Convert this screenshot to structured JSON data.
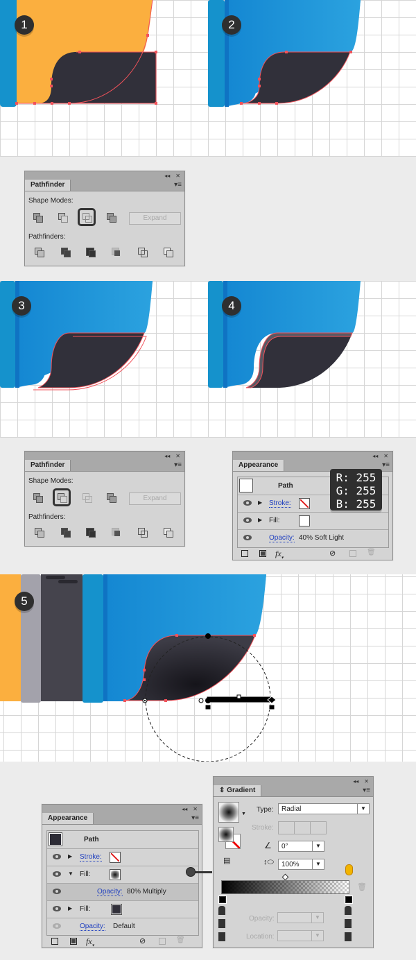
{
  "steps": [
    {
      "number": "1"
    },
    {
      "number": "2"
    },
    {
      "number": "3"
    },
    {
      "number": "4"
    },
    {
      "number": "5"
    }
  ],
  "colors": {
    "orange": "#fbaf3f",
    "blue": "#1a8fd6",
    "blue_dark": "#0f73c3",
    "dark_shape": "#31303a",
    "anchor_red": "#f2525a",
    "gray_strip": "#a3a2ab",
    "zipper": "#45444d"
  },
  "pathfinder_panel_1": {
    "title": "Pathfinder",
    "shape_modes_label": "Shape Modes:",
    "pathfinders_label": "Pathfinders:",
    "expand_label": "Expand",
    "selected_shape_mode": "intersect",
    "shape_modes": [
      "unite",
      "minus-front",
      "intersect",
      "exclude"
    ],
    "pathfinders": [
      "divide",
      "trim",
      "merge",
      "crop",
      "outline",
      "minus-back"
    ]
  },
  "pathfinder_panel_2": {
    "title": "Pathfinder",
    "shape_modes_label": "Shape Modes:",
    "pathfinders_label": "Pathfinders:",
    "expand_label": "Expand",
    "selected_shape_mode": "minus-front"
  },
  "appearance_panel_1": {
    "title": "Appearance",
    "header": "Path",
    "rows": [
      {
        "label": "Stroke:",
        "swatch": "none"
      },
      {
        "label": "Fill:",
        "swatch": "white"
      },
      {
        "label": "Opacity:",
        "value": "40% Soft Light"
      }
    ],
    "tooltip": {
      "r": "R: 255",
      "g": "G: 255",
      "b": "B: 255"
    }
  },
  "appearance_panel_2": {
    "title": "Appearance",
    "header": "Path",
    "rows": [
      {
        "label": "Stroke:",
        "swatch": "none"
      },
      {
        "label": "Fill:",
        "swatch": "radial-gradient"
      },
      {
        "label": "Opacity:",
        "value": "80% Multiply"
      },
      {
        "label": "Fill:",
        "swatch": "dark"
      },
      {
        "label": "Opacity:",
        "value": "Default"
      }
    ]
  },
  "gradient_panel": {
    "title": "Gradient",
    "type_label": "Type:",
    "type_value": "Radial",
    "stroke_label": "Stroke:",
    "angle_value": "0°",
    "aspect_value": "100%",
    "opacity_label": "Opacity:",
    "location_label": "Location:"
  },
  "footer_icons": [
    "new-stroke",
    "new-fill",
    "fx",
    "clear",
    "duplicate",
    "delete"
  ]
}
